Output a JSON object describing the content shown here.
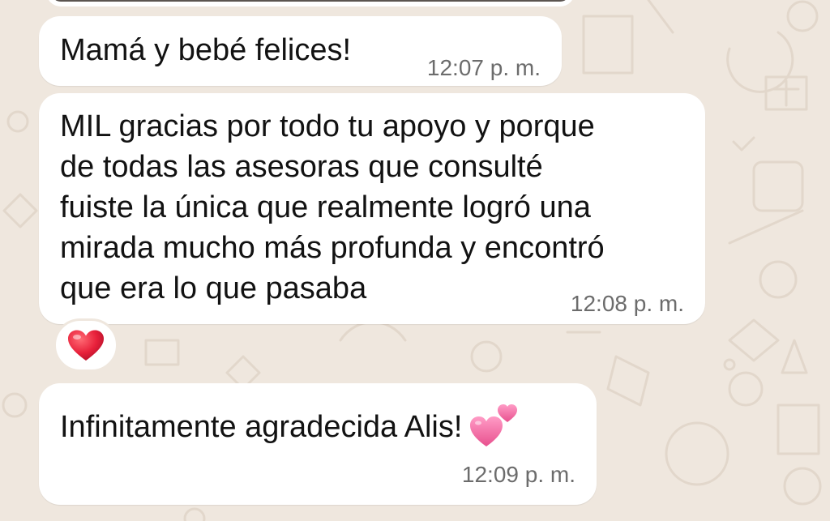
{
  "messages": [
    {
      "text": "Mamá y bebé felices!",
      "time": "12:07 p. m."
    },
    {
      "lines": [
        "MIL gracias por todo tu apoyo y porque",
        "de todas las asesoras que consulté",
        "fuiste la única que realmente logró una",
        "mirada mucho más profunda y encontró",
        "que era lo que pasaba"
      ],
      "time": "12:08 p. m.",
      "reaction": "red-heart-icon"
    },
    {
      "text": "Infinitamente agradecida Alis!",
      "time": "12:09 p. m.",
      "emoji": "two-hearts-icon"
    }
  ],
  "colors": {
    "wallpaper": "#efe7de",
    "bubble": "#ffffff",
    "text": "#121212",
    "timestamp": "#6c6c6c",
    "heart": "#e8213b",
    "pink_heart": "#f26aa0"
  }
}
